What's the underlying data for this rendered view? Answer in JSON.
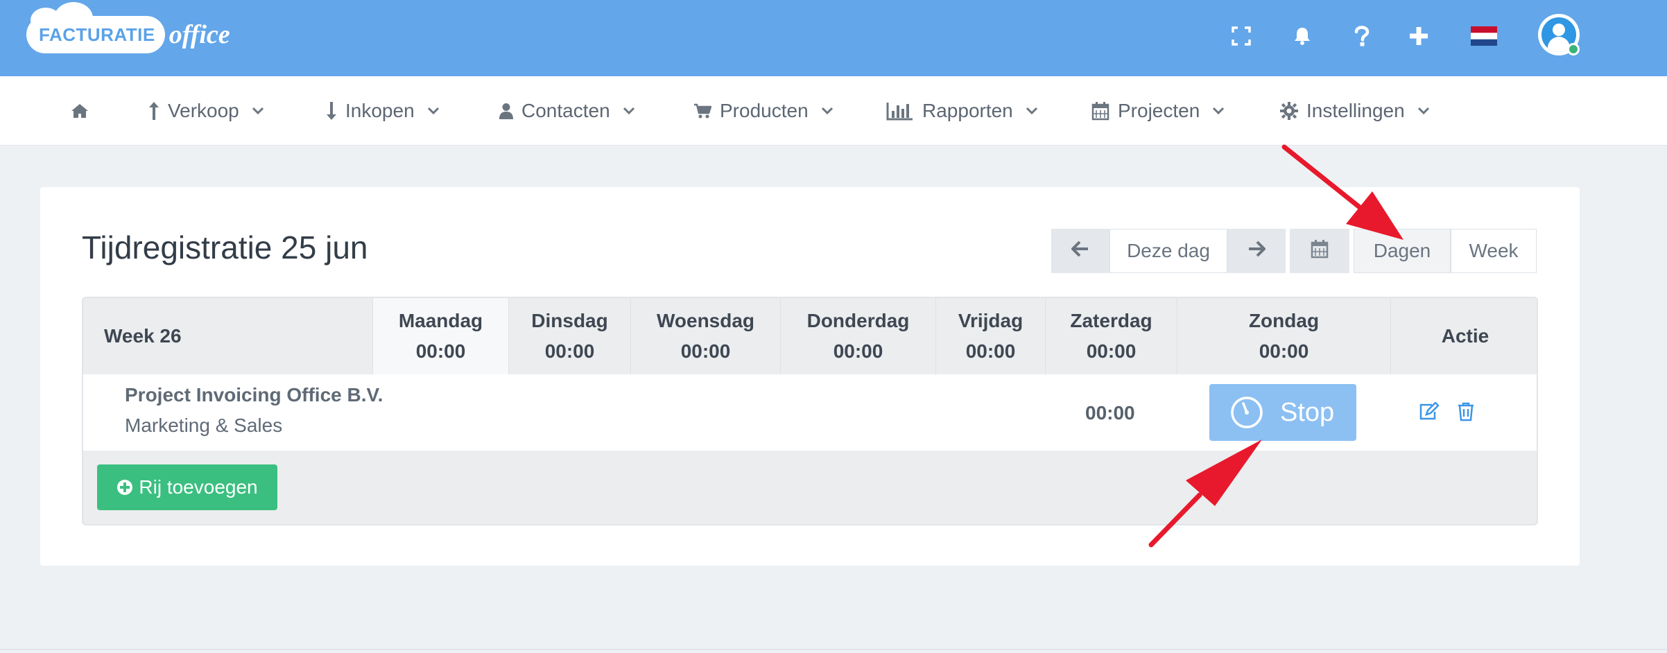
{
  "topbar": {
    "logo_word1": "FACTURATIE",
    "logo_word2": "office",
    "icons": [
      "expand-icon",
      "bell-icon",
      "help-icon",
      "plus-icon",
      "flag-nl-icon"
    ],
    "user_status": "online",
    "bg_color": "#63a6ea"
  },
  "nav": {
    "items": [
      {
        "icon": "home-icon",
        "label": ""
      },
      {
        "icon": "arrow-up-icon",
        "label": "Verkoop"
      },
      {
        "icon": "arrow-down-icon",
        "label": "Inkopen"
      },
      {
        "icon": "user-icon",
        "label": "Contacten"
      },
      {
        "icon": "cart-icon",
        "label": "Producten"
      },
      {
        "icon": "bar-chart-icon",
        "label": "Rapporten"
      },
      {
        "icon": "calendar-icon",
        "label": "Projecten"
      },
      {
        "icon": "gear-icon",
        "label": "Instellingen"
      }
    ]
  },
  "page": {
    "title": "Tijdregistratie 25 jun"
  },
  "controls": {
    "prev_icon": "arrow-left-icon",
    "today_label": "Deze dag",
    "next_icon": "arrow-right-icon",
    "calendar_icon": "calendar-icon",
    "view_days": "Dagen",
    "view_week": "Week"
  },
  "table": {
    "week_label": "Week 26",
    "days": [
      {
        "name": "Maandag",
        "total": "00:00"
      },
      {
        "name": "Dinsdag",
        "total": "00:00"
      },
      {
        "name": "Woensdag",
        "total": "00:00"
      },
      {
        "name": "Donderdag",
        "total": "00:00"
      },
      {
        "name": "Vrijdag",
        "total": "00:00"
      },
      {
        "name": "Zaterdag",
        "total": "00:00"
      },
      {
        "name": "Zondag",
        "total": "00:00"
      }
    ],
    "action_header": "Actie",
    "rows": [
      {
        "project": "Project Invoicing Office B.V.",
        "task": "Marketing & Sales",
        "saturday": "00:00",
        "timer_label": "Stop"
      }
    ],
    "add_row_label": "Rij toevoegen"
  },
  "colors": {
    "accent": "#63a6ea",
    "success": "#3bbf80",
    "timer": "#8cc0f2",
    "annotation": "#e8192c"
  }
}
